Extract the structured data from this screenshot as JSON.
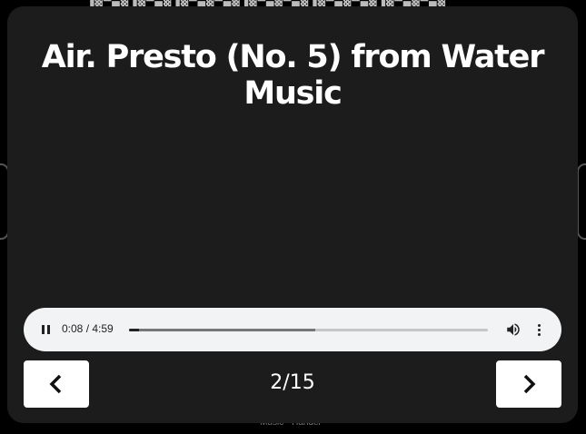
{
  "background": {
    "caption": "Music - Handel -"
  },
  "card": {
    "title": "Air. Presto (No. 5) from Water Music"
  },
  "player": {
    "state": "playing",
    "time_display": "0:08 / 4:59",
    "progress_fraction": 0.027,
    "buffered_fraction": 0.52,
    "icons": {
      "play_pause": "pause-icon",
      "volume": "volume-icon",
      "menu": "more-vert-icon"
    }
  },
  "navigation": {
    "counter": "2/15",
    "prev_icon": "chevron-left-icon",
    "next_icon": "chevron-right-icon"
  },
  "colors": {
    "card": "#1c1c1c",
    "page": "#000000",
    "player": "#f1f3f4",
    "button": "#ffffff"
  }
}
